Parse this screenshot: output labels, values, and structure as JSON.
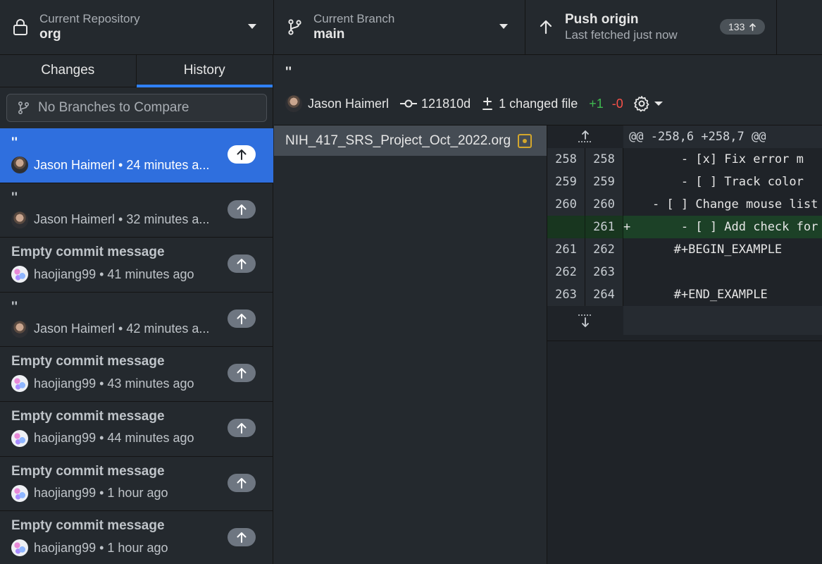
{
  "toolbar": {
    "repo": {
      "label": "Current Repository",
      "value": "org"
    },
    "branch": {
      "label": "Current Branch",
      "value": "main"
    },
    "push": {
      "title": "Push origin",
      "subtitle": "Last fetched just now",
      "count": "133"
    }
  },
  "sidebar": {
    "tabs": [
      {
        "label": "Changes",
        "active": false
      },
      {
        "label": "History",
        "active": true
      }
    ],
    "compare_placeholder": "No Branches to Compare",
    "commits": [
      {
        "title": "''",
        "author": "Jason Haimerl",
        "time": "24 minutes a...",
        "avatar": "jason",
        "selected": true
      },
      {
        "title": "''",
        "author": "Jason Haimerl",
        "time": "32 minutes a...",
        "avatar": "jason",
        "selected": false
      },
      {
        "title": "Empty commit message",
        "author": "haojiang99",
        "time": "41 minutes ago",
        "avatar": "hao",
        "selected": false
      },
      {
        "title": "''",
        "author": "Jason Haimerl",
        "time": "42 minutes a...",
        "avatar": "jason",
        "selected": false
      },
      {
        "title": "Empty commit message",
        "author": "haojiang99",
        "time": "43 minutes ago",
        "avatar": "hao",
        "selected": false
      },
      {
        "title": "Empty commit message",
        "author": "haojiang99",
        "time": "44 minutes ago",
        "avatar": "hao",
        "selected": false
      },
      {
        "title": "Empty commit message",
        "author": "haojiang99",
        "time": "1 hour ago",
        "avatar": "hao",
        "selected": false
      },
      {
        "title": "Empty commit message",
        "author": "haojiang99",
        "time": "1 hour ago",
        "avatar": "hao",
        "selected": false
      }
    ]
  },
  "commit_detail": {
    "title": "''",
    "author": "Jason Haimerl",
    "sha": "121810d",
    "changed_files": "1 changed file",
    "additions": "+1",
    "deletions": "-0"
  },
  "files": [
    {
      "name": "NIH_417_SRS_Project_Oct_2022.org",
      "status": "modified"
    }
  ],
  "diff": {
    "hunk_header": "@@ -258,6 +258,7 @@",
    "lines": [
      {
        "old": "258",
        "new": "258",
        "type": "context",
        "text": "        - [x] Fix error m"
      },
      {
        "old": "259",
        "new": "259",
        "type": "context",
        "text": "        - [ ] Track color"
      },
      {
        "old": "260",
        "new": "260",
        "type": "context",
        "text": "    - [ ] Change mouse list"
      },
      {
        "old": "",
        "new": "261",
        "type": "added",
        "text": "+       - [ ] Add check for"
      },
      {
        "old": "261",
        "new": "262",
        "type": "context",
        "text": "       #+BEGIN_EXAMPLE"
      },
      {
        "old": "262",
        "new": "263",
        "type": "context",
        "text": ""
      },
      {
        "old": "263",
        "new": "264",
        "type": "context",
        "text": "       #+END_EXAMPLE"
      }
    ]
  },
  "colors": {
    "accent": "#2f6fde",
    "added": "#3fb950",
    "deleted": "#f85149",
    "modified": "#d4a72c"
  }
}
